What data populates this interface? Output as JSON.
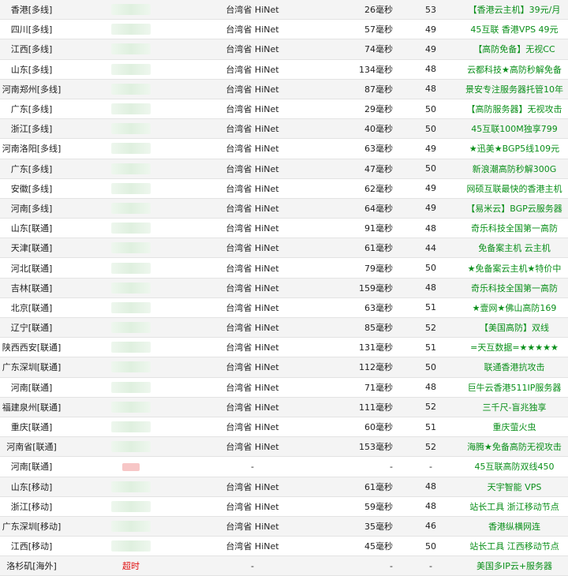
{
  "rows": [
    {
      "region": "香港[多线]",
      "location": "台湾省 HiNet",
      "time": "26毫秒",
      "ttl": "53",
      "ad": "【香港云主机】39元/月"
    },
    {
      "region": "四川[多线]",
      "location": "台湾省 HiNet",
      "time": "57毫秒",
      "ttl": "49",
      "ad": "45互联 香港VPS 49元"
    },
    {
      "region": "江西[多线]",
      "location": "台湾省 HiNet",
      "time": "74毫秒",
      "ttl": "49",
      "ad": "【高防免备】无视CC"
    },
    {
      "region": "山东[多线]",
      "location": "台湾省 HiNet",
      "time": "134毫秒",
      "ttl": "48",
      "ad": "云都科技★高防秒解免备"
    },
    {
      "region": "河南郑州[多线]",
      "location": "台湾省 HiNet",
      "time": "87毫秒",
      "ttl": "48",
      "ad": "景安专注服务器托管10年"
    },
    {
      "region": "广东[多线]",
      "location": "台湾省 HiNet",
      "time": "29毫秒",
      "ttl": "50",
      "ad": "【高防服务器】无视攻击"
    },
    {
      "region": "浙江[多线]",
      "location": "台湾省 HiNet",
      "time": "40毫秒",
      "ttl": "50",
      "ad": "45互联100M独享799"
    },
    {
      "region": "河南洛阳[多线]",
      "location": "台湾省 HiNet",
      "time": "63毫秒",
      "ttl": "49",
      "ad": "★迅美★BGP5线109元"
    },
    {
      "region": "广东[多线]",
      "location": "台湾省 HiNet",
      "time": "47毫秒",
      "ttl": "50",
      "ad": "新浪潮高防秒解300G"
    },
    {
      "region": "安徽[多线]",
      "location": "台湾省 HiNet",
      "time": "62毫秒",
      "ttl": "49",
      "ad": "网硕互联最快的香港主机"
    },
    {
      "region": "河南[多线]",
      "location": "台湾省 HiNet",
      "time": "64毫秒",
      "ttl": "49",
      "ad": "【易米云】BGP云服务器"
    },
    {
      "region": "山东[联通]",
      "location": "台湾省 HiNet",
      "time": "91毫秒",
      "ttl": "48",
      "ad": "奇乐科技全国第一高防"
    },
    {
      "region": "天津[联通]",
      "location": "台湾省 HiNet",
      "time": "61毫秒",
      "ttl": "44",
      "ad": "免备案主机 云主机"
    },
    {
      "region": "河北[联通]",
      "location": "台湾省 HiNet",
      "time": "79毫秒",
      "ttl": "50",
      "ad": "★免备案云主机★特价中"
    },
    {
      "region": "吉林[联通]",
      "location": "台湾省 HiNet",
      "time": "159毫秒",
      "ttl": "48",
      "ad": "奇乐科技全国第一高防"
    },
    {
      "region": "北京[联通]",
      "location": "台湾省 HiNet",
      "time": "63毫秒",
      "ttl": "51",
      "ad": "★壹网★佛山高防169"
    },
    {
      "region": "辽宁[联通]",
      "location": "台湾省 HiNet",
      "time": "85毫秒",
      "ttl": "52",
      "ad": "【美国高防】双线"
    },
    {
      "region": "陕西西安[联通]",
      "location": "台湾省 HiNet",
      "time": "131毫秒",
      "ttl": "51",
      "ad": "=天互数据=★★★★★"
    },
    {
      "region": "广东深圳[联通]",
      "location": "台湾省 HiNet",
      "time": "112毫秒",
      "ttl": "50",
      "ad": "联通香港抗攻击"
    },
    {
      "region": "河南[联通]",
      "location": "台湾省 HiNet",
      "time": "71毫秒",
      "ttl": "48",
      "ad": "巨牛云香港511IP服务器"
    },
    {
      "region": "福建泉州[联通]",
      "location": "台湾省 HiNet",
      "time": "111毫秒",
      "ttl": "52",
      "ad": "三千尺-盲兆独享"
    },
    {
      "region": "重庆[联通]",
      "location": "台湾省 HiNet",
      "time": "60毫秒",
      "ttl": "51",
      "ad": "重庆萤火虫"
    },
    {
      "region": "河南省[联通]",
      "location": "台湾省 HiNet",
      "time": "153毫秒",
      "ttl": "52",
      "ad": "海腾★免备高防无视攻击"
    },
    {
      "region": "河南[联通]",
      "location": "-",
      "time": "-",
      "ttl": "-",
      "ad": "45互联高防双线450",
      "failed": true
    },
    {
      "region": "山东[移动]",
      "location": "台湾省 HiNet",
      "time": "61毫秒",
      "ttl": "48",
      "ad": "天宇智能 VPS"
    },
    {
      "region": "浙江[移动]",
      "location": "台湾省 HiNet",
      "time": "59毫秒",
      "ttl": "48",
      "ad": "站长工具 浙江移动节点"
    },
    {
      "region": "广东深圳[移动]",
      "location": "台湾省 HiNet",
      "time": "35毫秒",
      "ttl": "46",
      "ad": "香港纵横网连"
    },
    {
      "region": "江西[移动]",
      "location": "台湾省 HiNet",
      "time": "45毫秒",
      "ttl": "50",
      "ad": "站长工具 江西移动节点"
    },
    {
      "region": "洛杉矶[海外]",
      "ip_status": "超时",
      "location": "-",
      "time": "-",
      "ttl": "-",
      "ad": "美国多IP云+服务器"
    }
  ]
}
